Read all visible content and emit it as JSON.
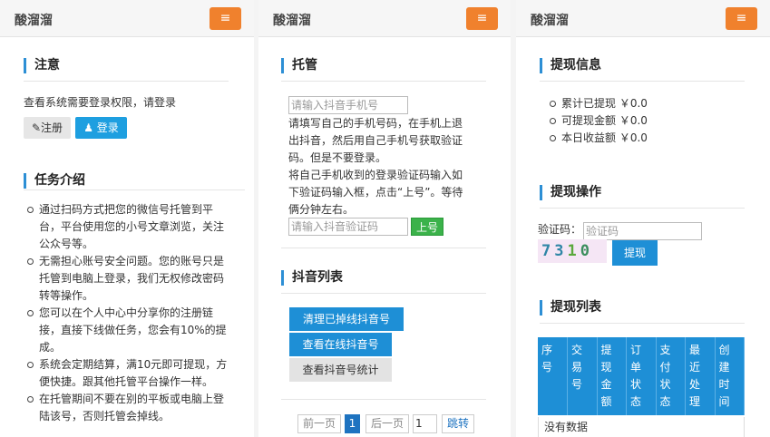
{
  "brand": "酸溜溜",
  "menu_icon": "≡",
  "panel1": {
    "notice_title": "注意",
    "notice_text": "查看系统需要登录权限，请登录",
    "register_label": "✎注册",
    "login_label": "♟ 登录",
    "task_title": "任务介绍",
    "task_items": [
      [
        "通过扫码方式把您的微信号托管到平",
        "台，平台使用您的小号文章浏览，关注",
        "公众号等。"
      ],
      [
        "无需担心账号安全问题。您的账号只是",
        "托管到电脑上登录，我们无权修改密码",
        "转等操作。"
      ],
      [
        "您可以在个人中心中分享你的注册链",
        "接，直接下线做任务，您会有10%的提",
        "成。"
      ],
      [
        "系统会定期结算，满10元即可提现，方",
        "便快捷。跟其他托管平台操作一样。"
      ],
      [
        "在托管期间不要在别的平板或电脑上登",
        "陆该号，否则托管会掉线。"
      ]
    ]
  },
  "panel2": {
    "host_title": "托管",
    "phone_placeholder": "请输入抖音手机号",
    "instructions": [
      "请填写自己的手机号码，在手机上退",
      "出抖音，然后用自己手机号获取验证",
      "码。但是不要登录。",
      "将自己手机收到的登录验证码输入如",
      "下验证码输入框，点击“上号”。等待",
      "俩分钟左右。"
    ],
    "code_placeholder": "请输入抖音验证码",
    "submit_label": "上号",
    "list_title": "抖音列表",
    "btn_clear": "清理已掉线抖音号",
    "btn_online": "查看在线抖音号",
    "btn_stats": "查看抖音号统计",
    "pager": {
      "prev": "前一页",
      "current": "1",
      "next": "后一页",
      "input_value": "1",
      "jump": "跳转"
    }
  },
  "panel3": {
    "info_title": "提现信息",
    "info_items": [
      "累计已提现 ￥0.0",
      "可提现金额 ￥0.0",
      "本日收益额 ￥0.0"
    ],
    "op_title": "提现操作",
    "captcha_label": "验证码：",
    "captcha_placeholder": "验证码",
    "captcha_chars": [
      "7",
      "3",
      "1",
      "0"
    ],
    "withdraw_label": "提现",
    "list_title": "提现列表",
    "columns": [
      [
        "序",
        "号"
      ],
      [
        "交",
        "易",
        "号"
      ],
      [
        "提",
        "现",
        "金",
        "额"
      ],
      [
        "订",
        "单",
        "状",
        "态"
      ],
      [
        "支",
        "付",
        "状",
        "态"
      ],
      [
        "最",
        "近",
        "处",
        "理"
      ],
      [
        "创",
        "建",
        "时",
        "间"
      ]
    ],
    "empty_text": "没有数据"
  }
}
